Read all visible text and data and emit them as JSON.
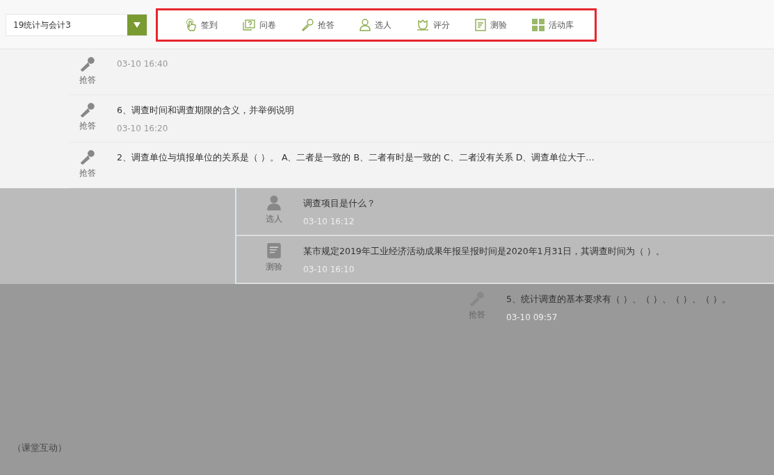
{
  "class_select": {
    "value": "19统计与会计3"
  },
  "toolbar": [
    {
      "label": "签到",
      "kind": "signin"
    },
    {
      "label": "问卷",
      "kind": "survey"
    },
    {
      "label": "抢答",
      "kind": "race"
    },
    {
      "label": "选人",
      "kind": "pick"
    },
    {
      "label": "评分",
      "kind": "score"
    },
    {
      "label": "测验",
      "kind": "quiz"
    },
    {
      "label": "活动库",
      "kind": "library"
    }
  ],
  "sections": [
    {
      "items": [
        {
          "kind": "race",
          "type_label": "抢答",
          "time": "03-10 16:40"
        },
        {
          "kind": "race",
          "title": "6、调查时间和调查期限的含义，并举例说明",
          "type_label": "抢答",
          "time": "03-10 16:20"
        },
        {
          "kind": "race",
          "title": "2、调查单位与填报单位的关系是（ ）。 A、二者是一致的 B、二者有时是一致的 C、二者没有关系 D、调查单位大于…",
          "type_label": "抢答"
        }
      ]
    },
    {
      "items": [
        {
          "kind": "pick",
          "title": "调查项目是什么？",
          "type_label": "选人",
          "time": "03-10 16:12"
        },
        {
          "kind": "quiz",
          "title": "某市规定2019年工业经济活动成果年报呈报时间是2020年1月31日，其调查时间为（ ）。",
          "type_label": "测验",
          "time": "03-10 16:10"
        }
      ]
    },
    {
      "items": [
        {
          "kind": "race",
          "title": "5、统计调查的基本要求有（ ）、（ ）、（ ）、（ ）。",
          "type_label": "抢答",
          "time": "03-10 09:57"
        }
      ]
    }
  ],
  "caption": "（课堂互动）"
}
